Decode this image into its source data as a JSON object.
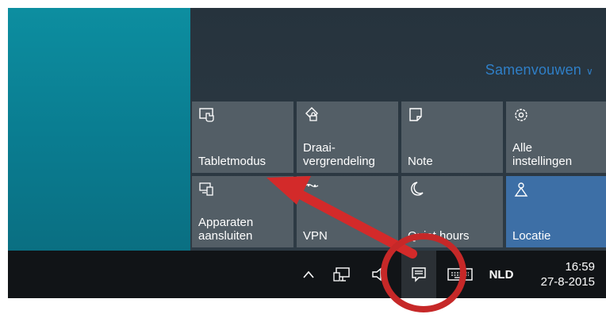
{
  "action_center": {
    "collapse_label": "Samenvouwen",
    "tiles": [
      {
        "label": "Tabletmodus",
        "icon": "tablet-mode-icon",
        "active": false
      },
      {
        "label": "Draai-\nvergrendeling",
        "icon": "rotation-lock-icon",
        "active": false
      },
      {
        "label": "Note",
        "icon": "note-icon",
        "active": false
      },
      {
        "label": "Alle\ninstellingen",
        "icon": "settings-gear-icon",
        "active": false
      },
      {
        "label": "Apparaten\naansluiten",
        "icon": "connect-devices-icon",
        "active": false
      },
      {
        "label": "VPN",
        "icon": "vpn-icon",
        "active": false
      },
      {
        "label": "Quiet hours",
        "icon": "moon-icon",
        "active": false
      },
      {
        "label": "Locatie",
        "icon": "location-icon",
        "active": true
      }
    ]
  },
  "taskbar": {
    "language": "NLD",
    "time": "16:59",
    "date": "27-8-2015"
  },
  "annotation": {
    "arrow_color": "#d32a2a",
    "circle_color": "#c62828"
  },
  "colors": {
    "tile": "#535e66",
    "tile_active": "#3d6fa6",
    "accent_link": "#2f7fc7"
  }
}
